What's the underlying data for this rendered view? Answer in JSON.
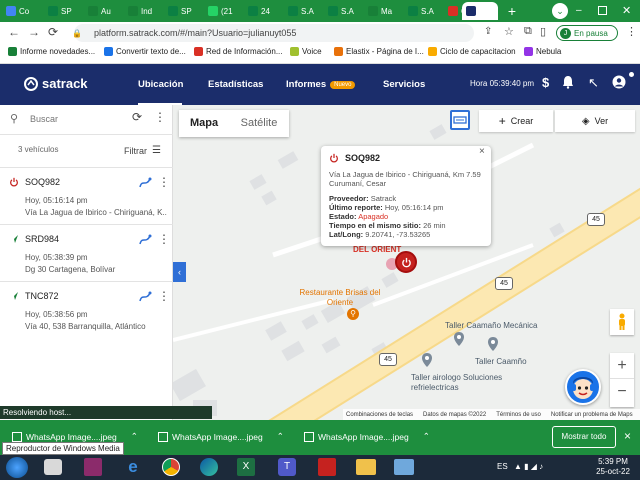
{
  "browser": {
    "tabs": [
      {
        "label": "Co",
        "color": "#4285f4"
      },
      {
        "label": "SP",
        "color": "#0b8043"
      },
      {
        "label": "Au",
        "color": "#188038"
      },
      {
        "label": "Ind",
        "color": "#188038"
      },
      {
        "label": "SP",
        "color": "#0b8043"
      },
      {
        "label": "(21",
        "color": "#25d366"
      },
      {
        "label": "24",
        "color": "#0b8043"
      },
      {
        "label": "S.A",
        "color": "#0b8043"
      },
      {
        "label": "S.A",
        "color": "#0b8043"
      },
      {
        "label": "Ma",
        "color": "#188038"
      },
      {
        "label": "S.A",
        "color": "#0b8043"
      },
      {
        "label": "Co",
        "color": "#d93025"
      },
      {
        "label": "",
        "color": "#1b2d6b"
      }
    ],
    "url": "platform.satrack.com/#/main?Usuario=julianuyt055",
    "profile_label": "En pausa",
    "profile_initial": "J",
    "bookmarks": [
      {
        "label": "Informe novedades...",
        "color": "#188038"
      },
      {
        "label": "Convertir texto de...",
        "color": "#1a73e8"
      },
      {
        "label": "Red de Información...",
        "color": "#d93025"
      },
      {
        "label": "Voice",
        "color": "#a0c02f"
      },
      {
        "label": "Elastix - Página de I...",
        "color": "#e8710a"
      },
      {
        "label": "Ciclo de capacitacion",
        "color": "#f9ab00"
      },
      {
        "label": "Nebula",
        "color": "#9334e6"
      }
    ]
  },
  "app": {
    "logo_text": "satrack",
    "nav": {
      "ubicacion": "Ubicación",
      "estadisticas": "Estadísticas",
      "informes": "Informes",
      "nuevo_badge": "Nuevo",
      "servicios": "Servicios"
    },
    "hora_label": "Hora 05:39:40 pm",
    "currency_icon": "$",
    "accent": "#1b2d6b"
  },
  "sidebar": {
    "search_placeholder": "Buscar",
    "count_label": "3 vehículos",
    "filter_label": "Filtrar",
    "vehicles": [
      {
        "plate": "SOQ982",
        "status": "off",
        "time": "Hoy, 05:16:14 pm",
        "address": "Vía La Jagua de Ibirico - Chiriguaná, K..."
      },
      {
        "plate": "SRD984",
        "status": "moving",
        "time": "Hoy, 05:38:39 pm",
        "address": "Dg 30 Cartagena, Bolívar"
      },
      {
        "plate": "TNC872",
        "status": "moving",
        "time": "Hoy, 05:38:56 pm",
        "address": "Vía 40, 538 Barranquilla, Atlántico"
      }
    ]
  },
  "map": {
    "tab_mapa": "Mapa",
    "tab_satelite": "Satélite",
    "crear_label": "Crear",
    "ver_label": "Ver",
    "road_label_1": "45",
    "road_label_2": "45",
    "road_label_3": "45",
    "place_1": "DEL ORIENT",
    "place_2": "Restaurante Brisas del Oriente",
    "place_3": "Taller Caamaño Mecánica",
    "place_4": "Taller Caamño",
    "place_5": "Taller airologo Soluciones refrielectricas",
    "zoom_in": "+",
    "zoom_out": "−",
    "footer": {
      "shortcuts": "Combinaciones de teclas",
      "mapdata": "Datos de mapas ©2022",
      "terms": "Términos de uso",
      "report": "Notificar un problema de Maps"
    }
  },
  "popup": {
    "plate": "SOQ982",
    "address_line1": "Vía La Jagua de Ibirico - Chiriguaná, Km 7.59",
    "address_line2": "Curumaní, Cesar",
    "provider_label": "Proveedor:",
    "provider_value": "Satrack",
    "last_report_label": "Último reporte:",
    "last_report_value": "Hoy, 05:16:14 pm",
    "state_label": "Estado:",
    "state_value": "Apagado",
    "time_label": "Tiempo en el mismo sitio:",
    "time_value": "26 min",
    "latlong_label": "Lat/Long:",
    "latlong_value": "9.20741, -73.53265",
    "close": "×"
  },
  "status": {
    "text": "Resolviendo host...",
    "tooltip": "Reproductor de Windows Media"
  },
  "downloads": {
    "items": [
      "WhatsApp Image....jpeg",
      "WhatsApp Image....jpeg",
      "WhatsApp Image....jpeg"
    ],
    "show_all": "Mostrar todo",
    "close": "×"
  },
  "taskbar": {
    "lang": "ES",
    "time": "5:39 PM",
    "date": "25-oct-22"
  }
}
